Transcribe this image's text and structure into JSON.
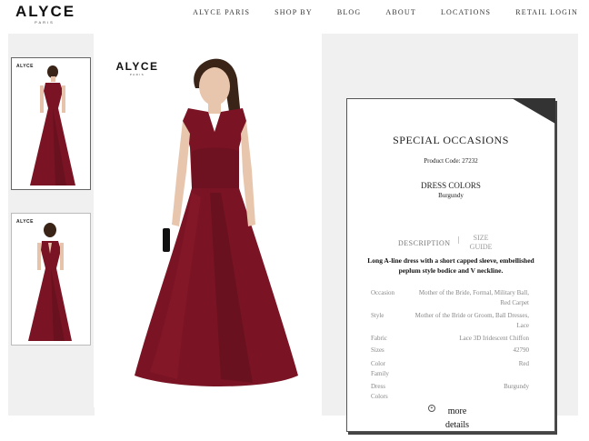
{
  "header": {
    "logo": {
      "brand": "ALYCE",
      "sub": "PARIS"
    },
    "nav": [
      "ALYCE PARIS",
      "SHOP BY",
      "BLOG",
      "ABOUT",
      "LOCATIONS",
      "RETAIL LOGIN"
    ]
  },
  "gallery": {
    "thumbs": [
      {
        "logo": "ALYCE",
        "view": "front"
      },
      {
        "logo": "ALYCE",
        "view": "back"
      }
    ]
  },
  "main_image": {
    "logo": "ALYCE",
    "sub": "PARIS"
  },
  "product": {
    "title": "SPECIAL OCCASIONS",
    "code": "Product Code: 27232",
    "colors_title": "DRESS COLORS",
    "colors_value": "Burgundy",
    "tabs": {
      "description": "DESCRIPTION",
      "separator": "|",
      "size_guide_1": "SIZE",
      "size_guide_2": "GUIDE"
    },
    "description": "Long A-line dress with a short capped sleeve, embellished peplum style bodice and V neckline.",
    "specs": [
      {
        "key": "Occasion",
        "value": "Mother of the Bride, Formal, Military Ball, Red Carpet"
      },
      {
        "key": "Style",
        "value": "Mother of the Bride or Groom, Ball Dresses, Lace"
      },
      {
        "key": "Fabric",
        "value": "Lace 3D Iridescent Chiffon"
      },
      {
        "key": "Sizes",
        "value": "42790"
      },
      {
        "key": "Color Family",
        "value": "Red"
      },
      {
        "key": "Dress Colors",
        "value": "Burgundy"
      }
    ],
    "more": "more details",
    "more_icon": "+"
  },
  "colors": {
    "burgundy": "#7a1424",
    "burgundy_dark": "#4e0b16",
    "card_border": "#555555"
  }
}
